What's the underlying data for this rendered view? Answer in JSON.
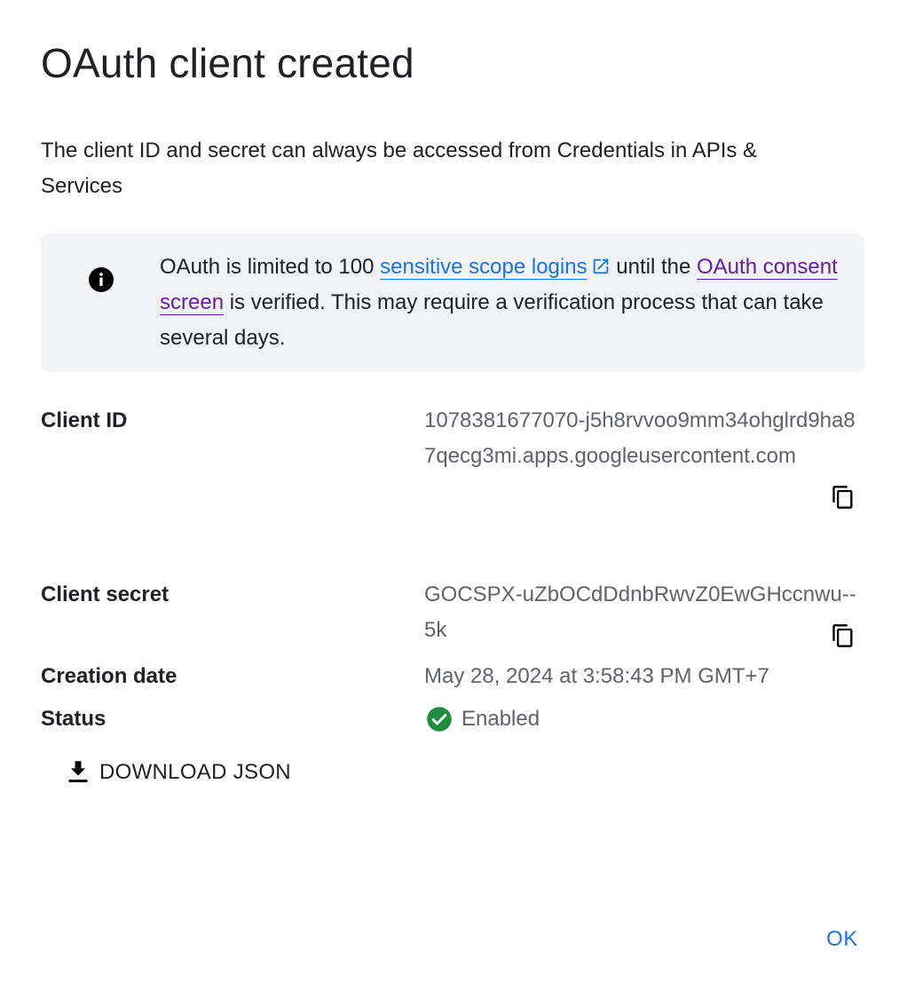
{
  "dialog": {
    "title": "OAuth client created",
    "subtitle": "The client ID and secret can always be accessed from Credentials in APIs & Services"
  },
  "notice": {
    "icon": "info-icon",
    "text_before": "OAuth is limited to 100 ",
    "link_sensitive": "sensitive scope logins",
    "link_sensitive_icon": "open-in-new-icon",
    "text_middle": " until the ",
    "link_consent": "OAuth consent screen",
    "text_after": " is verified. This may require a verification process that can take several days."
  },
  "fields": {
    "client_id": {
      "label": "Client ID",
      "value": "1078381677070-j5h8rvvoo9mm34ohglrd9ha87qecg3mi.apps.googleusercontent.com",
      "copy_icon": "copy-icon"
    },
    "client_secret": {
      "label": "Client secret",
      "value": "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",
      "copy_icon": "copy-icon"
    },
    "creation_date": {
      "label": "Creation date",
      "value": "May 28, 2024 at 3:58:43 PM GMT+7"
    },
    "status": {
      "label": "Status",
      "value": "Enabled",
      "icon": "check-circle-icon"
    }
  },
  "actions": {
    "download_label": "DOWNLOAD JSON",
    "download_icon": "download-icon",
    "ok_label": "OK"
  },
  "colors": {
    "link_blue": "#1a73e8",
    "link_visited": "#681da8",
    "notice_bg": "#f1f3f4",
    "success_green": "#1e8e3e",
    "text_primary": "#202124",
    "text_secondary": "#5f6368"
  }
}
